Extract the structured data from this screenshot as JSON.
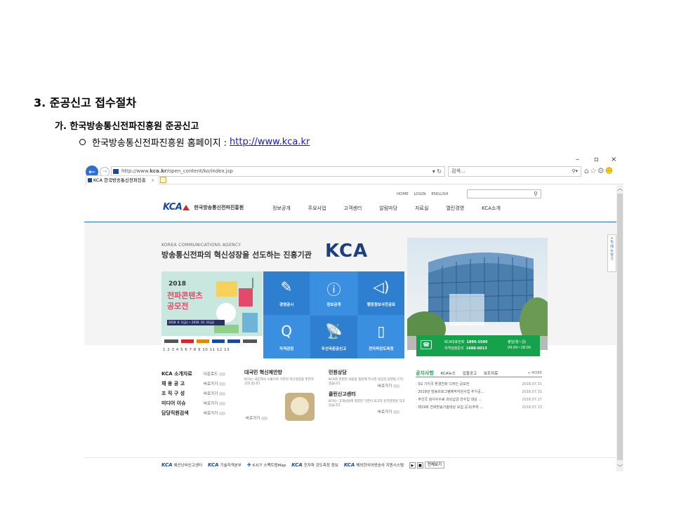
{
  "doc": {
    "heading": "3. 준공신고 접수절차",
    "subheading": "가. 한국방송통신전파진흥원 준공신고",
    "bullet_text": "한국방송통신전파진흥원 홈페이지 :",
    "bullet_link": "http://www.kca.kr"
  },
  "browser": {
    "window_controls": {
      "minimize": "–",
      "maximize": "▫",
      "close": "×"
    },
    "url_prefix": "http://www.",
    "url_domain": "kca.kr",
    "url_rest": "/open_content/ko/index.jsp",
    "search_placeholder": "검색...",
    "tab_title": "KCA 한국방송통신전파진흥",
    "tab_close": "×"
  },
  "site": {
    "util_nav": [
      "HOME",
      "LOGIN",
      "ENGLISH"
    ],
    "logo_mark": "KCA",
    "logo_text": "한국방송통신전파진흥원",
    "gnb": [
      "정보공개",
      "주요사업",
      "고객센터",
      "알림마당",
      "자료실",
      "열린경영",
      "KCA소개"
    ],
    "hero_sub": "KOREA COMMUNICATIONS AGENCY",
    "hero_title": "방송통신전파의 혁신성장을 선도하는 진흥기관",
    "hero_kca": "KCA",
    "poster_year": "2018",
    "poster_title1": "전파콘텐츠",
    "poster_title2": "공모전",
    "poster_date": "2018. 6. 1(금) ~ 2018. 10. 31(금)",
    "poster_pages": "1 2 3 4 5 6 7 8 9 10 11 12 13",
    "quick_links": [
      {
        "label": "경영공시",
        "icon": "pen-icon"
      },
      {
        "label": "정보공개",
        "icon": "info-icon"
      },
      {
        "label": "행정정보사전공표",
        "icon": "speaker-icon"
      },
      {
        "label": "자격검정",
        "icon": "q-icon"
      },
      {
        "label": "무선국준공신고",
        "icon": "satellite-icon"
      },
      {
        "label": "전자파강도측정",
        "icon": "phone-wave-icon"
      }
    ],
    "phone": {
      "main_label": "KCA대표전화",
      "main_num": "1899-5599",
      "cert_label": "자격검정문의",
      "cert_num": "1688-0013",
      "hours_label": "평일(월~금)",
      "hours": "09:00~18:00"
    },
    "side_float": [
      "+",
      "퀵",
      "메",
      "뉴",
      "열",
      "기"
    ],
    "menu": [
      {
        "label": "KCA 소개자료",
        "action": "다운로드"
      },
      {
        "label": "채 용 공 고",
        "action": "바로가기"
      },
      {
        "label": "조 직 구 성",
        "action": "바로가기"
      },
      {
        "label": "미디어 이슈",
        "action": "바로가기"
      },
      {
        "label": "담당직원검색",
        "action": "바로가기"
      }
    ],
    "proposal": {
      "title": "대국민 혁신제안방",
      "desc": "KCA는 국민과의 소통으로 기관의 혁신성장을 추진하고자 합니다",
      "action": "바로가기"
    },
    "civil": {
      "title1": "민원상담",
      "desc1": "KCA와 관련된 내용을 질문해 주시면 성심껏 답변을 드리겠습니다",
      "title2": "클린신고센터",
      "desc2": "KCA는 고객님들께 청렴한 기관이 되고자 윤리경영을 하고 있습니다",
      "action": "바로가기"
    },
    "notice": {
      "tabs": [
        "공지사항",
        "KCA뉴스",
        "입찰공고",
        "보도자료"
      ],
      "more": "+ MORE",
      "items": [
        {
          "title": "5G 기지국 환경친화 디자인 공모전",
          "date": "2018.07.31"
        },
        {
          "title": "2018년 방송프로그램제작지원사업 추가공...",
          "date": "2018.07.31"
        },
        {
          "title": "무선국 검사수수료 과오납금 잔수입 대상 ...",
          "date": "2018.07.17"
        },
        {
          "title": "제19회 전파방송기술대상 모집 공고(주최 ...",
          "date": "2018.07.13"
        }
      ]
    },
    "footer_banners": [
      "예산낭비신고센터",
      "기술자격본부",
      "K-ICT 스펙트럼Map",
      "전자파 강도측정 정보",
      "해외한국어방송사 지원시스템"
    ],
    "footer_all": "전체보기"
  }
}
